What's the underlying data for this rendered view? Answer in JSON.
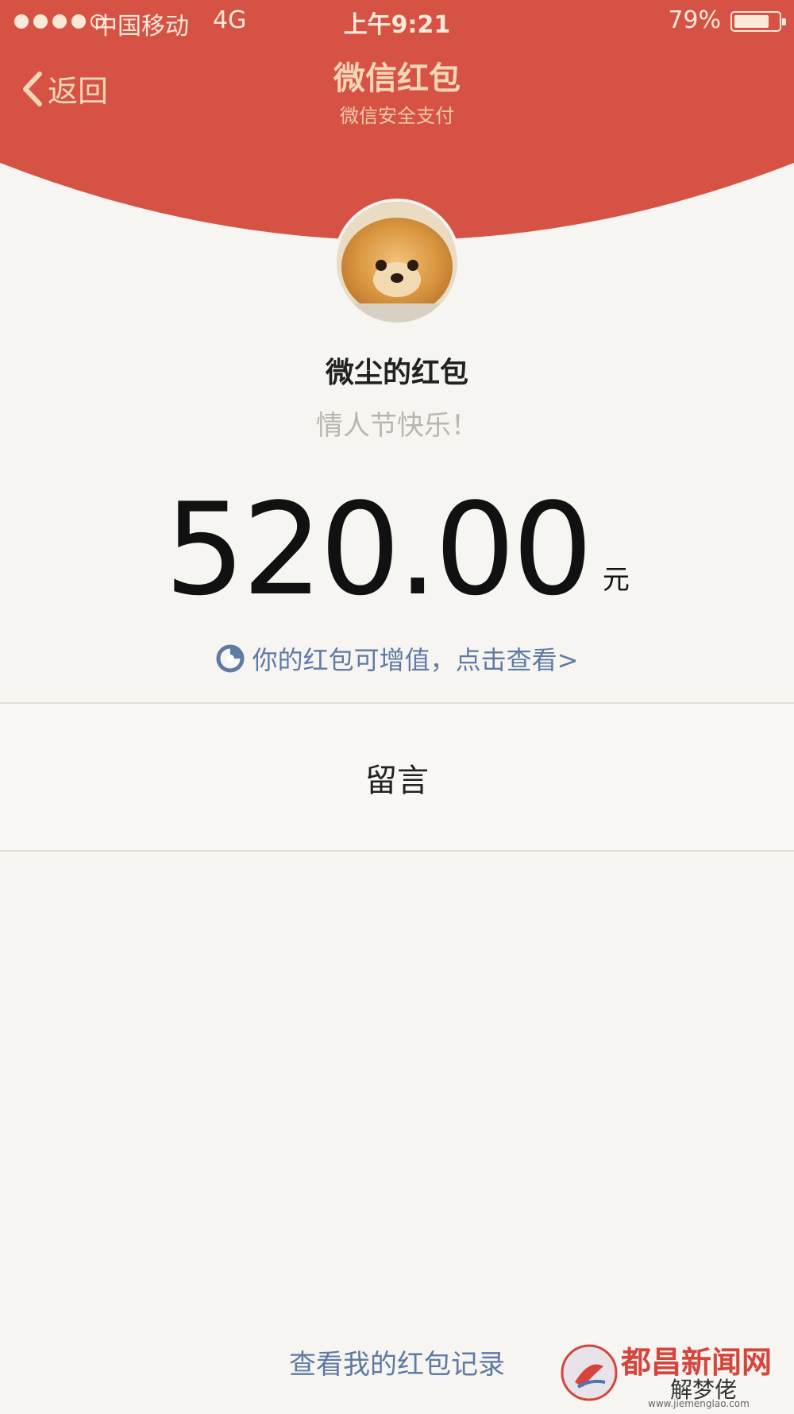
{
  "status_bar": {
    "signal_bars": [
      true,
      true,
      true,
      true,
      false
    ],
    "carrier": "中国移动",
    "network": "4G",
    "time": "上午9:21",
    "battery_percent_text": "79%",
    "battery_level": 0.79
  },
  "nav": {
    "back_label": "返回",
    "title": "微信红包",
    "subtitle": "微信安全支付"
  },
  "packet": {
    "sender": "微尘的红包",
    "greeting": "情人节快乐！",
    "amount": "520.00",
    "unit": "元",
    "promo_text": "你的红包可增值，点击查看>"
  },
  "actions": {
    "leave_message": "留言",
    "records_link": "查看我的红包记录"
  },
  "watermark": {
    "site_name": "都昌新闻网",
    "sub_text": "解梦佬",
    "url": "www.jiemenglao.com"
  },
  "colors": {
    "header_red": "#d65245",
    "header_text": "#f3d6b6",
    "link_blue": "#5f7aa3",
    "background": "#f6f5f1"
  },
  "icons": {
    "back": "chevron-left-icon",
    "promo": "wealth-growth-icon",
    "avatar": "dog-avatar"
  }
}
